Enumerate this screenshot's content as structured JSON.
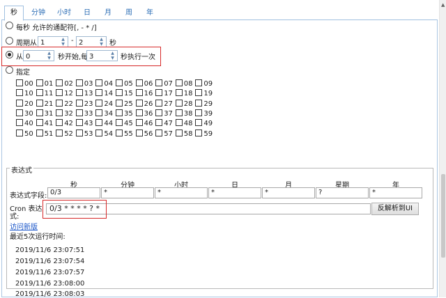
{
  "tabs": [
    "秒",
    "分钟",
    "小时",
    "日",
    "月",
    "周",
    "年"
  ],
  "options": {
    "every": "每秒 允许的通配符[, - * /]",
    "cycle": {
      "prefix": "周期从",
      "from": "1",
      "dash": "-",
      "to": "2",
      "suffix": "秒"
    },
    "from": {
      "prefix": "从",
      "start": "0",
      "middle": "秒开始,每",
      "step": "3",
      "suffix": "秒执行一次"
    },
    "specify": "指定"
  },
  "seconds": [
    "00",
    "01",
    "02",
    "03",
    "04",
    "05",
    "06",
    "07",
    "08",
    "09",
    "10",
    "11",
    "12",
    "13",
    "14",
    "15",
    "16",
    "17",
    "18",
    "19",
    "20",
    "21",
    "22",
    "23",
    "24",
    "25",
    "26",
    "27",
    "28",
    "29",
    "30",
    "31",
    "32",
    "33",
    "34",
    "35",
    "36",
    "37",
    "38",
    "39",
    "40",
    "41",
    "42",
    "43",
    "44",
    "45",
    "46",
    "47",
    "48",
    "49",
    "50",
    "51",
    "52",
    "53",
    "54",
    "55",
    "56",
    "57",
    "58",
    "59"
  ],
  "expression": {
    "title": "表达式",
    "columns": [
      "秒",
      "分钟",
      "小时",
      "日",
      "月",
      "星期",
      "年"
    ],
    "field_label": "表达式字段:",
    "fields": [
      "0/3",
      "*",
      "*",
      "*",
      "*",
      "?",
      "*"
    ],
    "cron_label_1": "Cron 表达",
    "cron_label_2": "式:",
    "cron_value": "0/3 * * * * ? *",
    "parse_button": "反解析到UI",
    "new_version_link": "访问新版",
    "runs_title": "最近5次运行时间:",
    "runs": [
      "2019/11/6 23:07:51",
      "2019/11/6 23:07:54",
      "2019/11/6 23:07:57",
      "2019/11/6 23:08:00",
      "2019/11/6 23:08:03"
    ]
  }
}
